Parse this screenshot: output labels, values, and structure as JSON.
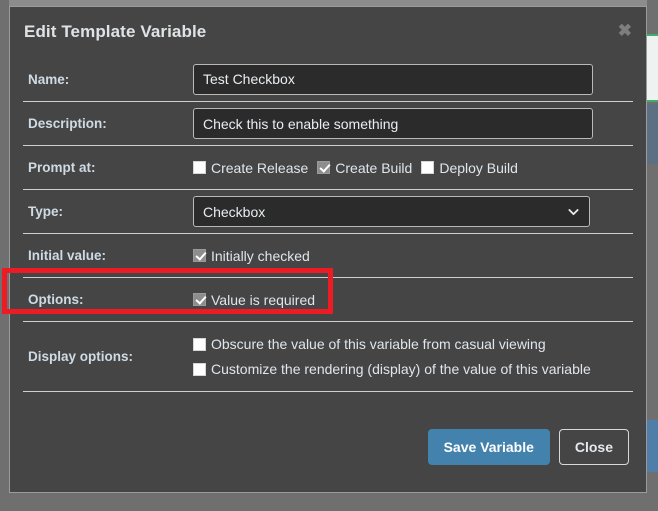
{
  "modal": {
    "title": "Edit Template Variable",
    "close_icon": "close-icon",
    "rows": {
      "name": {
        "label": "Name:",
        "value": "Test Checkbox"
      },
      "description": {
        "label": "Description:",
        "value": "Check this to enable something"
      },
      "prompt_at": {
        "label": "Prompt at:",
        "options": [
          {
            "label": "Create Release",
            "checked": false
          },
          {
            "label": "Create Build",
            "checked": true
          },
          {
            "label": "Deploy Build",
            "checked": false
          }
        ]
      },
      "type": {
        "label": "Type:",
        "value": "Checkbox",
        "chevron_icon": "chevron-down-icon"
      },
      "initial_value": {
        "label": "Initial value:",
        "options": [
          {
            "label": "Initially checked",
            "checked": true
          }
        ]
      },
      "options": {
        "label": "Options:",
        "options": [
          {
            "label": "Value is required",
            "checked": true
          }
        ]
      },
      "display_options": {
        "label": "Display options:",
        "options": [
          {
            "label": "Obscure the value of this variable from casual viewing",
            "checked": false
          },
          {
            "label": "Customize the rendering (display) of the value of this variable",
            "checked": false
          }
        ]
      }
    },
    "footer": {
      "save_label": "Save Variable",
      "close_label": "Close"
    }
  },
  "annotation": {
    "color": "#ed1c24",
    "target": "initial-value-row"
  },
  "colors": {
    "modal_background": "#454545",
    "input_background": "#2b2b2b",
    "label_text": "#cfdbe4",
    "primary_button": "#4282ad",
    "annotation_red": "#ed1c24"
  }
}
